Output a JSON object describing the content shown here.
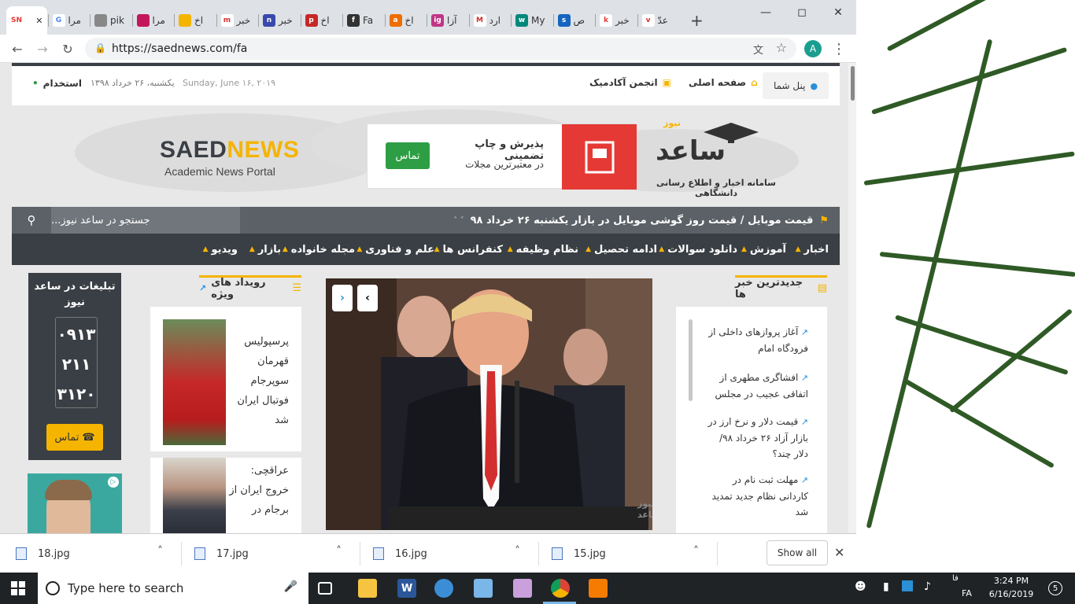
{
  "browser": {
    "tabs": [
      {
        "label": "",
        "favicon": "SN",
        "color": "#ffffff",
        "text_color": "#e53935"
      },
      {
        "label": "مرا",
        "favicon": "G",
        "color": "#ffffff",
        "text_color": "#4285f4"
      },
      {
        "label": "pik",
        "favicon": "globe",
        "color": "#888888",
        "text_color": "#ffffff"
      },
      {
        "label": "مرا",
        "favicon": "img",
        "color": "#c2185b",
        "text_color": "#ffffff"
      },
      {
        "label": "اخ",
        "favicon": "sun",
        "color": "#f5b400",
        "text_color": "#ffffff"
      },
      {
        "label": "خبر",
        "favicon": "m",
        "color": "#ffffff",
        "text_color": "#d32f2f"
      },
      {
        "label": "خبر",
        "favicon": "n",
        "color": "#3949ab",
        "text_color": "#ffffff"
      },
      {
        "label": "اخ",
        "favicon": "p",
        "color": "#c62828",
        "text_color": "#ffffff"
      },
      {
        "label": "Fa",
        "favicon": "f",
        "color": "#333333",
        "text_color": "#ffffff"
      },
      {
        "label": "اخ",
        "favicon": "a",
        "color": "#ef6c00",
        "text_color": "#ffffff"
      },
      {
        "label": "آزا",
        "favicon": "ig",
        "color": "#c13584",
        "text_color": "#ffffff"
      },
      {
        "label": "ارد",
        "favicon": "M",
        "color": "#ffffff",
        "text_color": "#d32f2f"
      },
      {
        "label": "My",
        "favicon": "w",
        "color": "#00897b",
        "text_color": "#ffffff"
      },
      {
        "label": "ص",
        "favicon": "s",
        "color": "#1565c0",
        "text_color": "#ffffff"
      },
      {
        "label": "خبر",
        "favicon": "k",
        "color": "#ffffff",
        "text_color": "#e53935"
      },
      {
        "label": "عدّ",
        "favicon": "v",
        "color": "#ffffff",
        "text_color": "#d32f2f"
      }
    ],
    "new_tab": "+",
    "url": "https://saednews.com/fa",
    "profile_initial": "A"
  },
  "topbar": {
    "panel": "پنل شما",
    "home": "صفحه اصلی",
    "academic": "انجمن آکادمیک",
    "date_en": "Sunday, June ۱۶, ۲۰۱۹",
    "date_fa": "یکشنبه، ۲۶ خرداد ۱۳۹۸",
    "jobs": "استخدام"
  },
  "brand": {
    "logo_saed": "SAED",
    "logo_news": "NEWS",
    "subtitle": "Academic News Portal",
    "logo_fa": "ساعد",
    "logo_fa_news": "نیوز",
    "logo_fa_sub": "سامانه اخبار و اطلاع رسانی دانشگاهی"
  },
  "ad_banner": {
    "line1": "پذیرش و چاپ تضمینی",
    "line2": "در معتبرترین مجلات",
    "button": "تماس"
  },
  "ticker": {
    "headline": "قیمت موبایل / قیمت روز گوشی موبایل در بازار یکشنبه ۲۶ خرداد ۹۸",
    "search_placeholder": "جستجو در ساعد نیوز..."
  },
  "nav": [
    "اخبار",
    "آموزش",
    "دانلود سوالات",
    "ادامه تحصیل",
    "نظام وظیفه",
    "کنفرانس ها",
    "علم و فناوری",
    "مجله خانواده",
    "بازار",
    "ویدیو"
  ],
  "ad_column": {
    "title": "تبلیغات در ساعد نیوز",
    "phone": [
      "۰۹۱۳",
      "۲۱۱",
      "۳۱۲۰"
    ],
    "button": "تماس"
  },
  "events": {
    "title": "رویداد های ویژه",
    "items": [
      {
        "text": "پرسپولیس قهرمان سوپرجام فوتبال ایران شد"
      },
      {
        "text": "عراقچی: خروج ایران از برجام در"
      }
    ]
  },
  "latest": {
    "title": "جدیدترین خبر ها",
    "items": [
      "آغاز پروازهای داخلی از فرودگاه امام",
      "افشاگری مطهری از اتفاقی عجیب در مجلس",
      "قیمت دلار و نرخ ارز در بازار آزاد ۲۶ خرداد ۹۸/ دلار چند؟",
      "مهلت ثبت نام در کاردانی نظام جدید تمدید شد"
    ]
  },
  "slider": {
    "watermark": "نیوز ساعد"
  },
  "downloads": {
    "files": [
      "18.jpg",
      "17.jpg",
      "16.jpg",
      "15.jpg"
    ],
    "show_all": "Show all"
  },
  "taskbar": {
    "search_placeholder": "Type here to search",
    "time": "3:24 PM",
    "date": "6/16/2019",
    "lang": "FA",
    "lang_fa": "فا",
    "notif_count": "5"
  },
  "colors": {
    "accent": "#f5b400",
    "nav_bg": "#3a3f45",
    "ticker_bg": "#5b6167",
    "ad_red": "#e53935",
    "ad_green": "#2e9e44"
  }
}
